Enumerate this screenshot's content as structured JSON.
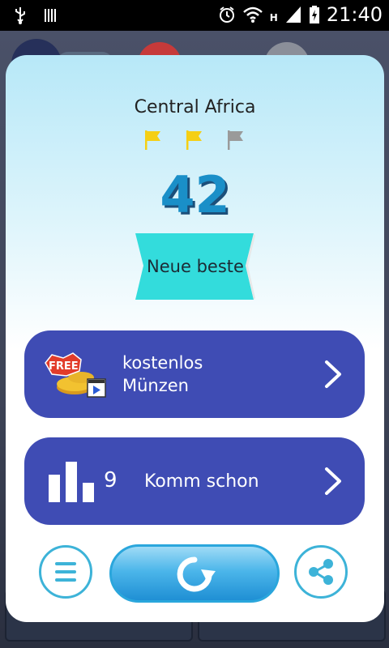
{
  "status_bar": {
    "time": "21:40",
    "icons": [
      "usb-icon",
      "barcode-icon",
      "alarm-icon",
      "wifi-icon",
      "h-network-icon",
      "signal-icon",
      "battery-charging-icon"
    ],
    "network_label": "H"
  },
  "dialog": {
    "level_name": "Central Africa",
    "flags": [
      {
        "icon": "flag-icon",
        "color": "#f5cf14",
        "earned": true
      },
      {
        "icon": "flag-icon",
        "color": "#f5cf14",
        "earned": true
      },
      {
        "icon": "flag-icon",
        "color": "#9a9a9a",
        "earned": false
      }
    ],
    "score": "42",
    "ribbon_label": "Neue beste",
    "free_coins": {
      "line1": "kostenlos",
      "line2": "Münzen",
      "badge_text": "FREE"
    },
    "leaderboard": {
      "count": "9",
      "label": "Komm schon"
    },
    "buttons": {
      "menu": "menu-icon",
      "replay": "replay-icon",
      "share": "share-icon"
    }
  },
  "colors": {
    "action_button": "#3f4cb4",
    "accent_cyan": "#33dcdc",
    "score_blue": "#1a8fc8",
    "circle_border": "#3db3d8"
  }
}
